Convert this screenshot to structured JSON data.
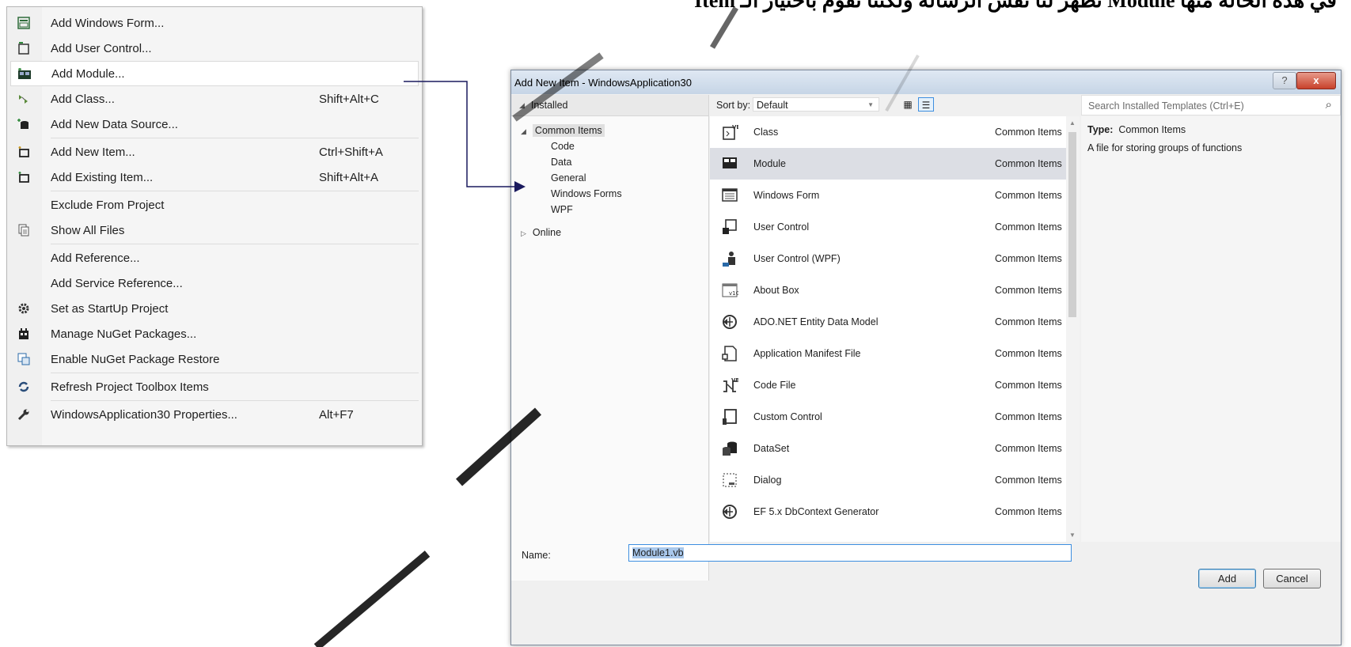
{
  "heading": "Item تظهر لنا نفس الرسالة ولكننا نقوم باختيار الـ Module في هذه الحالة منها",
  "context_menu": {
    "items": [
      {
        "label": "Add Windows Form...",
        "shortcut": "",
        "icon": "form-icon"
      },
      {
        "label": "Add User Control...",
        "shortcut": "",
        "icon": "user-control-icon"
      },
      {
        "label": "Add Module...",
        "shortcut": "",
        "icon": "module-icon",
        "highlighted": true
      },
      {
        "label": "Add Class...",
        "shortcut": "Shift+Alt+C",
        "icon": "class-icon"
      },
      {
        "label": "Add New Data Source...",
        "shortcut": "",
        "icon": "datasource-icon"
      },
      {
        "label": "Add New Item...",
        "shortcut": "Ctrl+Shift+A",
        "icon": "new-item-icon"
      },
      {
        "label": "Add Existing Item...",
        "shortcut": "Shift+Alt+A",
        "icon": "existing-item-icon"
      },
      {
        "label": "Exclude From Project",
        "shortcut": "",
        "icon": ""
      },
      {
        "label": "Show All Files",
        "shortcut": "",
        "icon": "show-files-icon"
      },
      {
        "label": "Add Reference...",
        "shortcut": "",
        "icon": ""
      },
      {
        "label": "Add Service Reference...",
        "shortcut": "",
        "icon": ""
      },
      {
        "label": "Set as StartUp Project",
        "shortcut": "",
        "icon": "gear-icon"
      },
      {
        "label": "Manage NuGet Packages...",
        "shortcut": "",
        "icon": "nuget-icon"
      },
      {
        "label": "Enable NuGet Package Restore",
        "shortcut": "",
        "icon": "restore-icon"
      },
      {
        "label": "Refresh Project Toolbox Items",
        "shortcut": "",
        "icon": "refresh-icon"
      },
      {
        "label": "WindowsApplication30 Properties...",
        "shortcut": "Alt+F7",
        "icon": "wrench-icon"
      }
    ]
  },
  "dialog": {
    "title": "Add New Item - WindowsApplication30",
    "help_glyph": "?",
    "close_glyph": "x",
    "installed_label": "Installed",
    "tree": {
      "common_items": "Common Items",
      "children": [
        "Code",
        "Data",
        "General",
        "Windows Forms",
        "WPF"
      ],
      "online": "Online"
    },
    "sort_label": "Sort by:",
    "sort_value": "Default",
    "search_placeholder": "Search Installed Templates (Ctrl+E)",
    "templates": [
      {
        "name": "Class",
        "category": "Common Items",
        "icon": "class-template-icon"
      },
      {
        "name": "Module",
        "category": "Common Items",
        "icon": "module-template-icon",
        "selected": true
      },
      {
        "name": "Windows Form",
        "category": "Common Items",
        "icon": "windows-form-template-icon"
      },
      {
        "name": "User Control",
        "category": "Common Items",
        "icon": "user-control-template-icon"
      },
      {
        "name": "User Control (WPF)",
        "category": "Common Items",
        "icon": "wpf-user-control-template-icon"
      },
      {
        "name": "About Box",
        "category": "Common Items",
        "icon": "about-box-template-icon"
      },
      {
        "name": "ADO.NET Entity Data Model",
        "category": "Common Items",
        "icon": "entity-model-template-icon"
      },
      {
        "name": "Application Manifest File",
        "category": "Common Items",
        "icon": "manifest-template-icon"
      },
      {
        "name": "Code File",
        "category": "Common Items",
        "icon": "code-file-template-icon"
      },
      {
        "name": "Custom Control",
        "category": "Common Items",
        "icon": "custom-control-template-icon"
      },
      {
        "name": "DataSet",
        "category": "Common Items",
        "icon": "dataset-template-icon"
      },
      {
        "name": "Dialog",
        "category": "Common Items",
        "icon": "dialog-template-icon"
      },
      {
        "name": "EF 5.x DbContext Generator",
        "category": "Common Items",
        "icon": "ef-generator-template-icon"
      }
    ],
    "type_label": "Type:",
    "type_value": "Common Items",
    "description": "A file for storing groups of functions",
    "name_label": "Name:",
    "name_value": "Module1.vb",
    "add_button": "Add",
    "cancel_button": "Cancel"
  },
  "colors": {
    "accent": "#3d8ee0",
    "selected_row": "#dcdee4",
    "close_button": "#c8412b",
    "arrow": "#1a1a5e"
  }
}
